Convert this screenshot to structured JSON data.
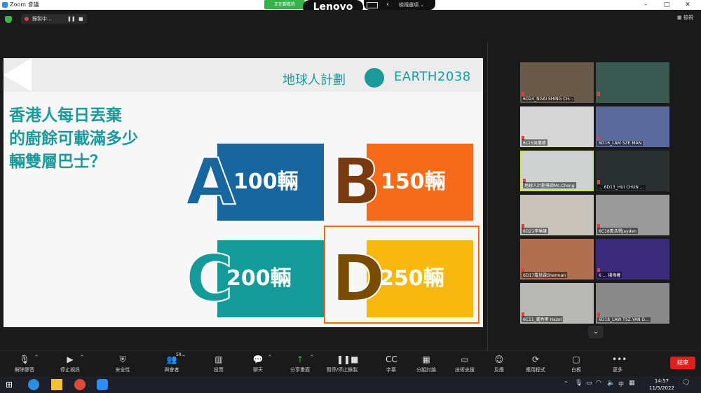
{
  "window": {
    "title": "Zoom 會議",
    "minimize": "–",
    "maximize": "□",
    "close": "✕"
  },
  "top": {
    "sharing_pill": "正在觀看的",
    "brand": "Lenovo",
    "view_label": "檢視選項 ⌄",
    "rec_text": "錄製中...",
    "pause": "❚❚",
    "stop": "■",
    "view_btn": "檢視"
  },
  "slide": {
    "logo_cn": "地球人計劃",
    "logo_en": "EARTH2038",
    "question_lines": [
      "香港人每日丟棄",
      "的廚餘可載滿多少",
      "輛雙層巴士？"
    ],
    "options": [
      {
        "letter": "A",
        "value": "100輛",
        "color": "#1766a0",
        "letter_color": "#1766a0"
      },
      {
        "letter": "B",
        "value": "150輛",
        "color": "#f56b1a",
        "letter_color": "#7a3a10"
      },
      {
        "letter": "C",
        "value": "200輛",
        "color": "#159a9a",
        "letter_color": "#159a9a"
      },
      {
        "letter": "D",
        "value": "250輛",
        "color": "#f7b90f",
        "letter_color": "#7a4c00"
      }
    ]
  },
  "gallery": [
    {
      "name": "6D24_NGAI SHING CH...",
      "bg": "#6a5a4a"
    },
    {
      "name": "",
      "bg": "#3a5a52"
    },
    {
      "name": "6c15吳儀德",
      "bg": "#d6d6d6"
    },
    {
      "name": "6D16_LAM SZE MAN",
      "bg": "#5a6a9a"
    },
    {
      "name": "地球人計劃導師Ms.Cheng",
      "bg": "#cfd2d0"
    },
    {
      "name": "... 6D13_HUI CHUN ...",
      "bg": "#2a3030"
    },
    {
      "name": "6D21李琳謙",
      "bg": "#c8c4bc"
    },
    {
      "name": "6C18黃浩賢Jayden",
      "bg": "#9a9a9a"
    },
    {
      "name": "6D17羅慧霖Sherman",
      "bg": "#b07050"
    },
    {
      "name": "6 ... 楊偉權",
      "bg": "#3a2a7a"
    },
    {
      "name": "6C11_鍾秀雨 Hazel",
      "bg": "#b8b8b4"
    },
    {
      "name": "6D18_LAW TSZ YAN G...",
      "bg": "#8a8a8a"
    }
  ],
  "gallery_down": "⌄",
  "toolbar": [
    {
      "label": "解除靜音",
      "icon": "🎙",
      "caret": "^"
    },
    {
      "label": "停止視訊",
      "icon": "▶",
      "caret": "^"
    },
    {
      "label": "安全性",
      "icon": "⛨",
      "caret": ""
    },
    {
      "label": "與會者",
      "icon": "👥",
      "caret": "^",
      "count": "58"
    },
    {
      "label": "投票",
      "icon": "▥",
      "caret": ""
    },
    {
      "label": "聊天",
      "icon": "💬",
      "caret": "^"
    },
    {
      "label": "分享畫面",
      "icon": "↑",
      "caret": "^"
    },
    {
      "label": "暫停/停止錄製",
      "icon": "❚❚■",
      "caret": ""
    },
    {
      "label": "字幕",
      "icon": "CC",
      "caret": ""
    },
    {
      "label": "分組討論",
      "icon": "▦",
      "caret": ""
    },
    {
      "label": "技術支援",
      "icon": "▭",
      "caret": ""
    },
    {
      "label": "反應",
      "icon": "☺",
      "caret": ""
    },
    {
      "label": "應用程式",
      "icon": "⟳",
      "caret": ""
    },
    {
      "label": "白板",
      "icon": "▢",
      "caret": ""
    },
    {
      "label": "更多",
      "icon": "•••",
      "caret": ""
    }
  ],
  "end_button": "結束",
  "tray": {
    "time": "14:57",
    "date": "11/5/2022",
    "lang": "中"
  }
}
